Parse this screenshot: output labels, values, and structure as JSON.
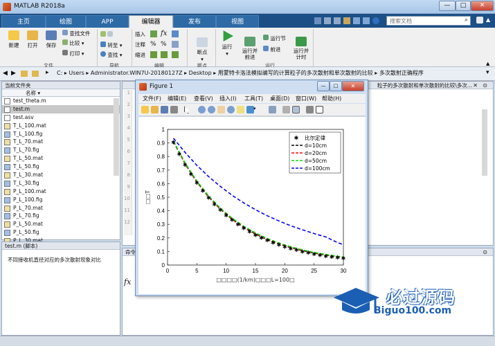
{
  "window": {
    "title": "MATLAB R2018a",
    "minimize": "—",
    "maximize": "□",
    "close": "✕"
  },
  "tabs": [
    {
      "label": "主页",
      "active": false
    },
    {
      "label": "绘图",
      "active": false
    },
    {
      "label": "APP",
      "active": false
    },
    {
      "label": "编辑器",
      "active": true
    },
    {
      "label": "发布",
      "active": false
    },
    {
      "label": "视图",
      "active": false
    }
  ],
  "search": {
    "placeholder": "搜索文档"
  },
  "ribbon": {
    "file": {
      "new": "新建",
      "open": "打开",
      "save": "保存",
      "find_files": "查找文件",
      "compare": "比较",
      "print": "打印",
      "section": "文件"
    },
    "navigate": {
      "goto": "转至",
      "find": "查找",
      "section": "导航"
    },
    "edit": {
      "insert": "插入",
      "comment": "注释",
      "indent": "缩进",
      "section": "编辑"
    },
    "breakpoints": {
      "label": "断点",
      "section": "断点"
    },
    "run": {
      "run": "运行",
      "run_advance": "运行并\n前进",
      "run_section": "运行节",
      "advance": "前进",
      "run_time": "运行并\n计时",
      "section": "运行"
    }
  },
  "address": {
    "segments": [
      "C:",
      "Users",
      "Administrator.WIN7U-20180127Z",
      "Desktop",
      "用蒙特卡洛法模拟编写的计算粒子的多次散射和单次散射的比较",
      "多次散射正确程序"
    ]
  },
  "current_folder": {
    "title": "当前文件夹",
    "column": "名称 ▾",
    "files": [
      {
        "name": "test_theta.m",
        "selected": false
      },
      {
        "name": "test.m",
        "selected": true
      },
      {
        "name": "test.asv",
        "selected": false
      },
      {
        "name": "T_L_100.mat",
        "selected": false
      },
      {
        "name": "T_L_100.fig",
        "selected": false
      },
      {
        "name": "T_L_70.mat",
        "selected": false
      },
      {
        "name": "T_L_70.fig",
        "selected": false
      },
      {
        "name": "T_L_50.mat",
        "selected": false
      },
      {
        "name": "T_L_50.fig",
        "selected": false
      },
      {
        "name": "T_L_30.mat",
        "selected": false
      },
      {
        "name": "T_L_30.fig",
        "selected": false
      },
      {
        "name": "P_L_100.mat",
        "selected": false
      },
      {
        "name": "P_L_100.fig",
        "selected": false
      },
      {
        "name": "P_L_70.mat",
        "selected": false
      },
      {
        "name": "P_L_70.fig",
        "selected": false
      },
      {
        "name": "P_L_50.mat",
        "selected": false
      },
      {
        "name": "P_L_50.fig",
        "selected": false
      },
      {
        "name": "P_L_30.mat",
        "selected": false
      },
      {
        "name": "P_L_30.fig",
        "selected": false
      }
    ]
  },
  "details": {
    "title": "test.m  (脚本)",
    "text": "不同接收机直径对应的多次散射现象对比"
  },
  "editor": {
    "header": "粒子的多次散射和单次散射的比较\\多次...",
    "lines": [
      "1",
      "2",
      "3",
      "4",
      "5",
      "6",
      "7",
      "8",
      "9",
      "10",
      "11",
      "12"
    ]
  },
  "command_window": {
    "title": "命令",
    "prompt": "fx"
  },
  "figure": {
    "title": "Figure 1",
    "menu": [
      "文件(F)",
      "编辑(E)",
      "查看(V)",
      "插入(I)",
      "工具(T)",
      "桌面(D)",
      "窗口(W)",
      "帮助(H)"
    ]
  },
  "chart_data": {
    "type": "line",
    "xlabel": "□□□□(1/km)□□□L=100□",
    "ylabel": "□□T",
    "xlim": [
      0,
      30
    ],
    "ylim": [
      0,
      1
    ],
    "xticks": [
      0,
      5,
      10,
      15,
      20,
      25,
      30
    ],
    "yticks": [
      0,
      0.1,
      0.2,
      0.3,
      0.4,
      0.5,
      0.6,
      0.7,
      0.8,
      0.9,
      1
    ],
    "legend_position": "top-right",
    "series": [
      {
        "name": "比尔定律",
        "style": "star",
        "color": "#000000",
        "x": [
          1,
          2,
          3,
          4,
          5,
          6,
          7,
          8,
          9,
          10,
          11,
          12,
          13,
          14,
          15,
          16,
          17,
          18,
          19,
          20,
          21,
          22,
          23,
          24,
          25,
          26,
          27,
          28,
          29,
          30
        ],
        "y": [
          0.905,
          0.819,
          0.741,
          0.67,
          0.607,
          0.549,
          0.497,
          0.449,
          0.407,
          0.368,
          0.333,
          0.301,
          0.273,
          0.247,
          0.223,
          0.202,
          0.183,
          0.165,
          0.15,
          0.135,
          0.122,
          0.111,
          0.1,
          0.091,
          0.082,
          0.074,
          0.067,
          0.061,
          0.055,
          0.05
        ]
      },
      {
        "name": "d=10cm",
        "style": "dash",
        "color": "#000000",
        "x": [
          1,
          3,
          5,
          7,
          9,
          11,
          13,
          15,
          17,
          19,
          21,
          23,
          25,
          27,
          29,
          30
        ],
        "y": [
          0.91,
          0.745,
          0.612,
          0.502,
          0.412,
          0.338,
          0.278,
          0.229,
          0.188,
          0.155,
          0.128,
          0.106,
          0.088,
          0.073,
          0.06,
          0.055
        ]
      },
      {
        "name": "d=20cm",
        "style": "dash",
        "color": "#ff0000",
        "x": [
          1,
          3,
          5,
          7,
          9,
          11,
          13,
          15,
          17,
          19,
          21,
          23,
          25,
          27,
          29,
          30
        ],
        "y": [
          0.912,
          0.748,
          0.615,
          0.505,
          0.415,
          0.341,
          0.281,
          0.232,
          0.191,
          0.158,
          0.131,
          0.109,
          0.09,
          0.075,
          0.062,
          0.057
        ]
      },
      {
        "name": "d=50cm",
        "style": "dash",
        "color": "#00dd00",
        "x": [
          1,
          3,
          5,
          7,
          9,
          11,
          13,
          15,
          17,
          19,
          21,
          23,
          25,
          27,
          29,
          30
        ],
        "y": [
          0.915,
          0.752,
          0.62,
          0.51,
          0.42,
          0.346,
          0.286,
          0.237,
          0.196,
          0.162,
          0.135,
          0.112,
          0.093,
          0.078,
          0.065,
          0.06
        ]
      },
      {
        "name": "d=100cm",
        "style": "dash",
        "color": "#0000ff",
        "x": [
          1,
          3,
          5,
          7,
          9,
          11,
          13,
          15,
          17,
          19,
          21,
          23,
          25,
          27,
          29,
          30
        ],
        "y": [
          0.935,
          0.83,
          0.735,
          0.652,
          0.58,
          0.515,
          0.458,
          0.408,
          0.364,
          0.325,
          0.29,
          0.26,
          0.232,
          0.207,
          0.166,
          0.15
        ]
      }
    ]
  },
  "watermark": {
    "text": "必过源码",
    "url": "Biguo100.com"
  }
}
